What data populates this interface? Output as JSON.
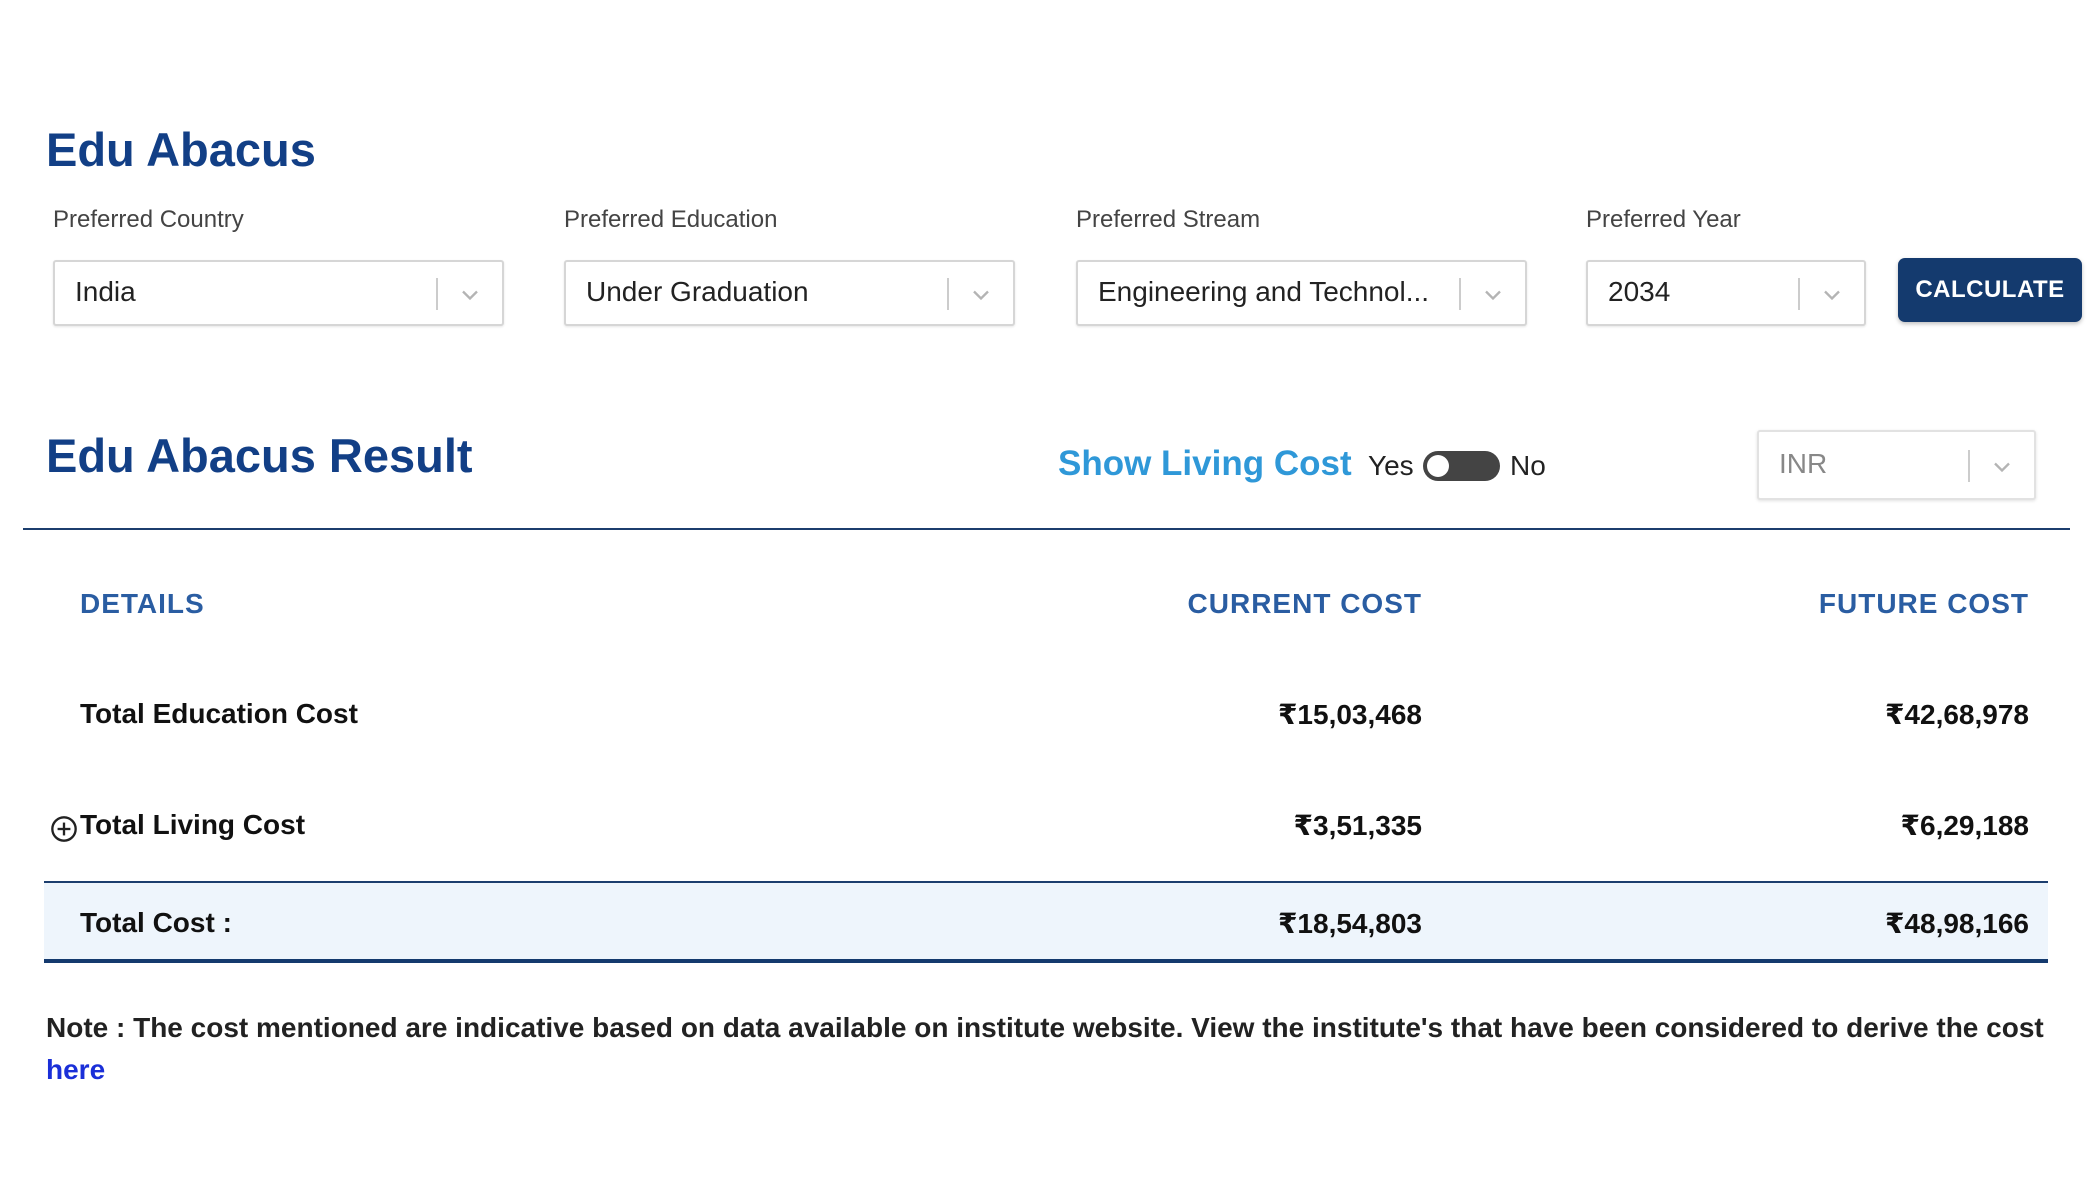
{
  "header": {
    "title": "Edu Abacus"
  },
  "filters": [
    {
      "label": "Preferred Country",
      "value": "India"
    },
    {
      "label": "Preferred Education",
      "value": "Under Graduation"
    },
    {
      "label": "Preferred Stream",
      "value": "Engineering and Technol..."
    },
    {
      "label": "Preferred Year",
      "value": "2034"
    }
  ],
  "calculate_label": "CALCULATE",
  "result": {
    "title": "Edu Abacus Result",
    "living_cost_label": "Show Living Cost",
    "toggle_yes": "Yes",
    "toggle_no": "No",
    "currency": "INR"
  },
  "table": {
    "headers": [
      "DETAILS",
      "CURRENT COST",
      "FUTURE COST"
    ],
    "rows": [
      {
        "label": "Total Education Cost",
        "current": "₹15,03,468",
        "future": "₹42,68,978"
      },
      {
        "label": "Total Living Cost",
        "current": "₹3,51,335",
        "future": "₹6,29,188"
      }
    ],
    "total": {
      "label": "Total Cost :",
      "current": "₹18,54,803",
      "future": "₹48,98,166"
    }
  },
  "note": {
    "text": "Note : The cost mentioned are indicative based on data available on institute website. View the institute's that have been considered to derive the cost",
    "link_label": "here"
  },
  "colors": {
    "heading": "#123f86",
    "button": "#143a6e",
    "living_label": "#2f98d8",
    "column_header": "#2a5da2",
    "link": "#1a2fd8",
    "total_band": "#eef5fc"
  },
  "icons": {
    "dropdown": "chevron-down-icon",
    "expand": "plus-circle-icon"
  }
}
